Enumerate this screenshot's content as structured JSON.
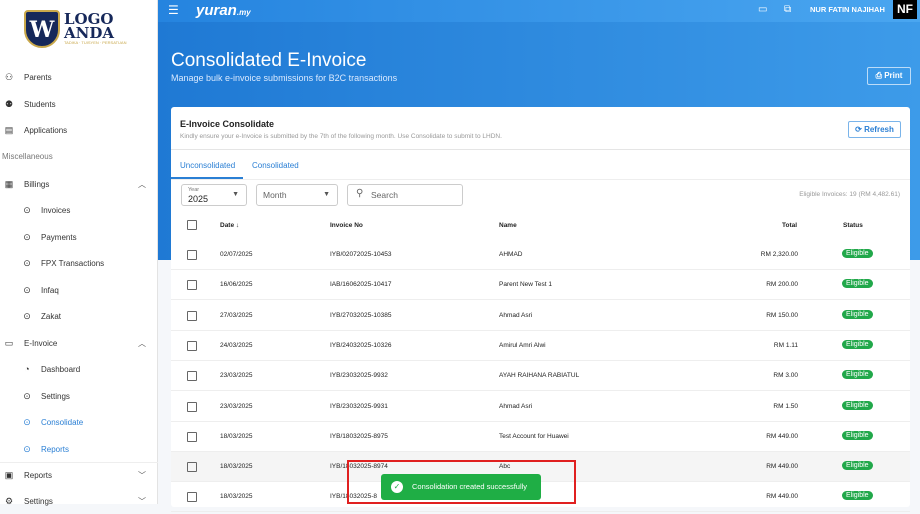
{
  "logo": {
    "title_line1": "LOGO",
    "title_line2": "ANDA",
    "tagline": "TADIKA · TUISYEN · PERSATUAN",
    "mark": "W"
  },
  "sidebar": {
    "items": [
      {
        "label": "Parents",
        "icon": "parents-icon"
      },
      {
        "label": "Students",
        "icon": "students-icon"
      },
      {
        "label": "Applications",
        "icon": "applications-icon"
      }
    ],
    "section": "Miscellaneous",
    "billings": {
      "label": "Billings",
      "children": [
        "Invoices",
        "Payments",
        "FPX Transactions",
        "Infaq",
        "Zakat"
      ]
    },
    "einvoice": {
      "label": "E-Invoice",
      "children": [
        "Dashboard",
        "Settings",
        "Consolidate",
        "Reports"
      ]
    },
    "reports": "Reports",
    "settings": "Settings"
  },
  "topbar": {
    "brand": "yuran",
    "brand_suffix": ".my",
    "user": "NUR FATIN NAJIHAH",
    "avatar": "NF"
  },
  "page": {
    "title": "Consolidated E-Invoice",
    "subtitle": "Manage bulk e-invoice submissions for B2C transactions",
    "print": "Print"
  },
  "card": {
    "title": "E-Invoice Consolidate",
    "description": "Kindly ensure your e-Invoice is submitted by the 7th of the following month. Use Consolidate to submit to LHDN.",
    "refresh": "Refresh",
    "tabs": [
      "Unconsolidated",
      "Consolidated"
    ],
    "filters": {
      "year_label": "Year",
      "year_value": "2025",
      "month_placeholder": "Month",
      "search_placeholder": "Search"
    },
    "eligible_summary": "Eligible Invoices: 19 (RM 4,482.61)",
    "columns": [
      "Date",
      "Invoice No",
      "Name",
      "Total",
      "Status"
    ],
    "rows": [
      {
        "date": "02/07/2025",
        "invoice": "IYB/02072025-10453",
        "name": "AHMAD",
        "total": "RM 2,320.00",
        "status": "Eligible"
      },
      {
        "date": "16/06/2025",
        "invoice": "IAB/16062025-10417",
        "name": "Parent New Test 1",
        "total": "RM 200.00",
        "status": "Eligible"
      },
      {
        "date": "27/03/2025",
        "invoice": "IYB/27032025-10385",
        "name": "Ahmad Asri",
        "total": "RM 150.00",
        "status": "Eligible"
      },
      {
        "date": "24/03/2025",
        "invoice": "IYB/24032025-10326",
        "name": "Amirul Amri Alwi",
        "total": "RM 1.11",
        "status": "Eligible"
      },
      {
        "date": "23/03/2025",
        "invoice": "IYB/23032025-9932",
        "name": "AYAH RAIHANA RABIATUL",
        "total": "RM 3.00",
        "status": "Eligible"
      },
      {
        "date": "23/03/2025",
        "invoice": "IYB/23032025-9931",
        "name": "Ahmad Asri",
        "total": "RM 1.50",
        "status": "Eligible"
      },
      {
        "date": "18/03/2025",
        "invoice": "IYB/18032025-8975",
        "name": "Test Account for Huawei",
        "total": "RM 449.00",
        "status": "Eligible"
      },
      {
        "date": "18/03/2025",
        "invoice": "IYB/18032025-8974",
        "name": "Abc",
        "total": "RM 449.00",
        "status": "Eligible"
      },
      {
        "date": "18/03/2025",
        "invoice": "IYB/18032025-8",
        "name": "",
        "total": "RM 449.00",
        "status": "Eligible"
      }
    ]
  },
  "toast": {
    "message": "Consolidation created successfully"
  },
  "colors": {
    "primary": "#2a7fd4",
    "success": "#1fae45",
    "highlight": "#e02020"
  }
}
